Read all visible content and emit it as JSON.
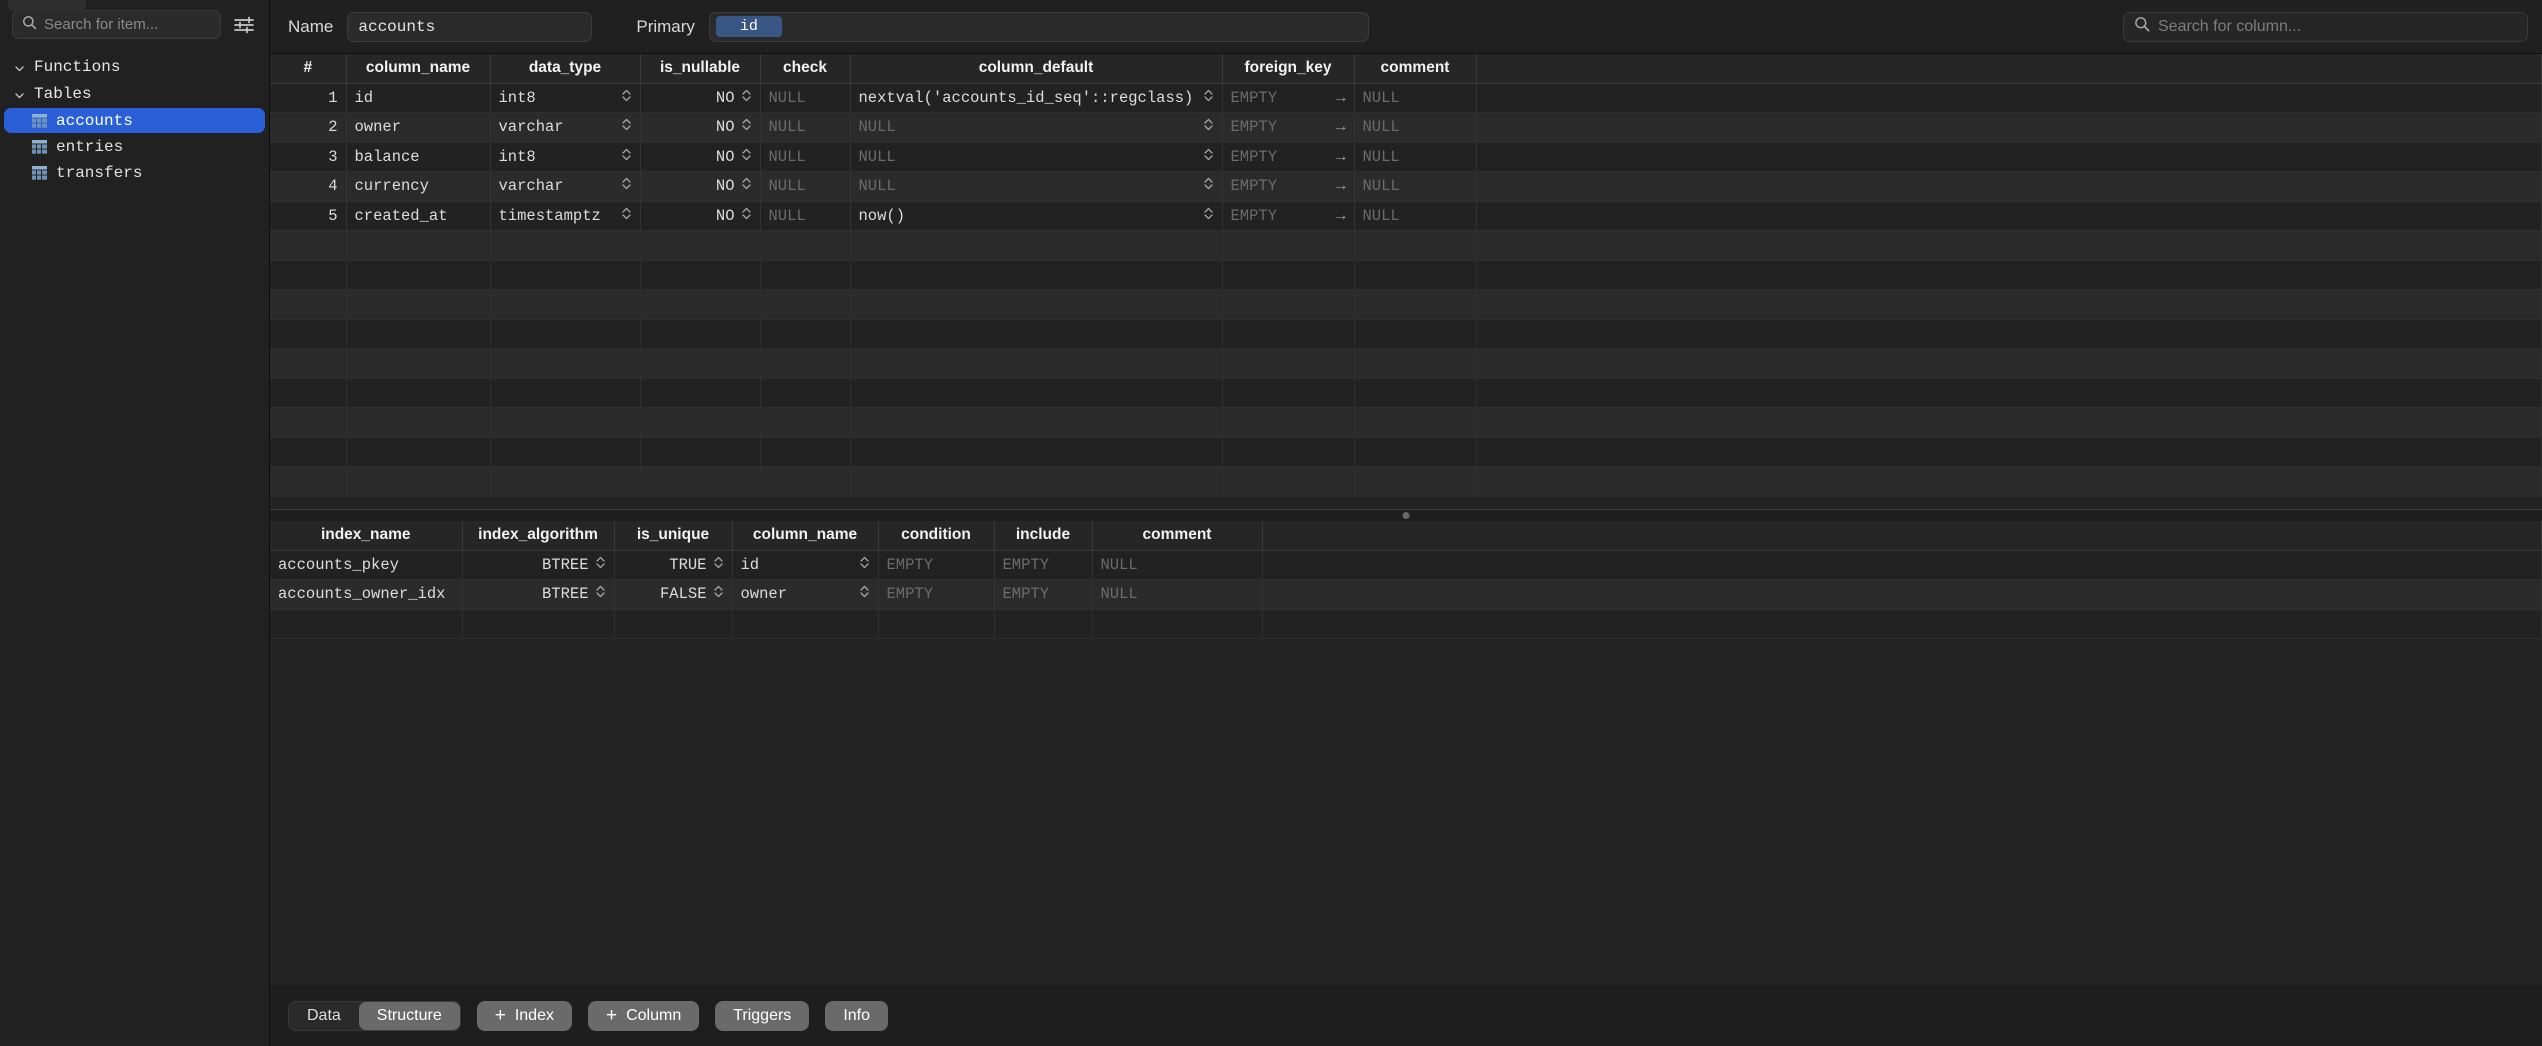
{
  "sidebar": {
    "search_placeholder": "Search for item...",
    "filter_icon": "sliders-icon",
    "groups": [
      {
        "label": "Functions",
        "items": []
      },
      {
        "label": "Tables",
        "items": [
          {
            "label": "accounts",
            "selected": true
          },
          {
            "label": "entries",
            "selected": false
          },
          {
            "label": "transfers",
            "selected": false
          }
        ]
      }
    ]
  },
  "toolbar": {
    "name_label": "Name",
    "name_value": "accounts",
    "primary_label": "Primary",
    "primary_value": "id",
    "column_search_placeholder": "Search for column..."
  },
  "columns_grid": {
    "headers": [
      "#",
      "column_name",
      "data_type",
      "is_nullable",
      "check",
      "column_default",
      "foreign_key",
      "comment",
      ""
    ],
    "rows": [
      {
        "num": "1",
        "column_name": "id",
        "data_type": "int8",
        "is_nullable": "NO",
        "check": "NULL",
        "column_default": "nextval('accounts_id_seq'::regclass)",
        "foreign_key": "EMPTY",
        "comment": "NULL"
      },
      {
        "num": "2",
        "column_name": "owner",
        "data_type": "varchar",
        "is_nullable": "NO",
        "check": "NULL",
        "column_default": "NULL",
        "foreign_key": "EMPTY",
        "comment": "NULL"
      },
      {
        "num": "3",
        "column_name": "balance",
        "data_type": "int8",
        "is_nullable": "NO",
        "check": "NULL",
        "column_default": "NULL",
        "foreign_key": "EMPTY",
        "comment": "NULL"
      },
      {
        "num": "4",
        "column_name": "currency",
        "data_type": "varchar",
        "is_nullable": "NO",
        "check": "NULL",
        "column_default": "NULL",
        "foreign_key": "EMPTY",
        "comment": "NULL"
      },
      {
        "num": "5",
        "column_name": "created_at",
        "data_type": "timestamptz",
        "is_nullable": "NO",
        "check": "NULL",
        "column_default": "now()",
        "foreign_key": "EMPTY",
        "comment": "NULL"
      }
    ],
    "empty_row_count": 9,
    "placeholder_null": "NULL",
    "placeholder_empty": "EMPTY",
    "fk_arrow": "arrow-right-icon"
  },
  "index_grid": {
    "headers": [
      "index_name",
      "index_algorithm",
      "is_unique",
      "column_name",
      "condition",
      "include",
      "comment",
      ""
    ],
    "rows": [
      {
        "index_name": "accounts_pkey",
        "index_algorithm": "BTREE",
        "is_unique": "TRUE",
        "column_name": "id",
        "condition": "EMPTY",
        "include": "EMPTY",
        "comment": "NULL"
      },
      {
        "index_name": "accounts_owner_idx",
        "index_algorithm": "BTREE",
        "is_unique": "FALSE",
        "column_name": "owner",
        "condition": "EMPTY",
        "include": "EMPTY",
        "comment": "NULL"
      }
    ]
  },
  "bottombar": {
    "segments": [
      {
        "label": "Data",
        "active": false
      },
      {
        "label": "Structure",
        "active": true
      }
    ],
    "buttons": [
      {
        "label": "Index",
        "icon": "plus-icon"
      },
      {
        "label": "Column",
        "icon": "plus-icon"
      },
      {
        "label": "Triggers",
        "icon": null
      },
      {
        "label": "Info",
        "icon": null
      }
    ]
  },
  "colors": {
    "selection_blue": "#2a5fd8",
    "pk_chip_blue": "#3a5684",
    "table_icon_blue": "#6f93b8",
    "button_gray": "#6a6a6a"
  }
}
